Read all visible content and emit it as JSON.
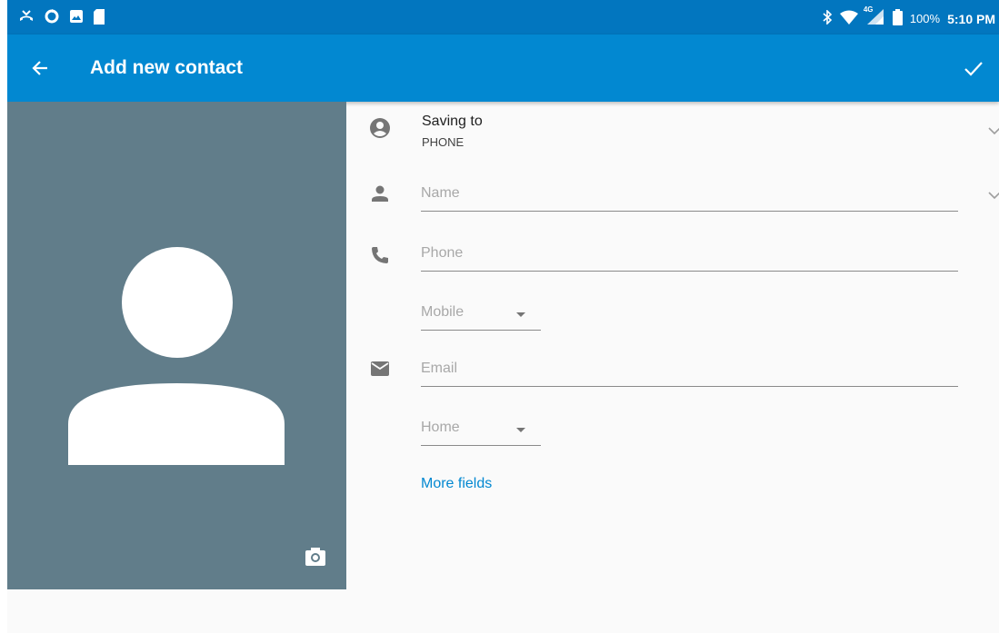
{
  "status_bar": {
    "left_icons": [
      "missed-call-icon",
      "sync-icon",
      "photo-icon",
      "sd-card-icon"
    ],
    "right_icons": [
      "bluetooth-icon",
      "wifi-icon",
      "signal-4g-icon",
      "battery-icon"
    ],
    "network": "4G",
    "battery": "100%",
    "time": "5:10 PM"
  },
  "app_bar": {
    "title": "Add new contact",
    "back_icon": "arrow-back-icon",
    "save_icon": "check-icon"
  },
  "account": {
    "label": "Saving to",
    "value": "PHONE"
  },
  "fields": {
    "name_placeholder": "Name",
    "phone_placeholder": "Phone",
    "phone_type": "Mobile",
    "email_placeholder": "Email",
    "email_type": "Home"
  },
  "more_fields": "More fields",
  "colors": {
    "status_bar": "#0276bf",
    "app_bar": "#0288d1",
    "photo_bg": "#617d8a",
    "accent": "#0288d1"
  }
}
